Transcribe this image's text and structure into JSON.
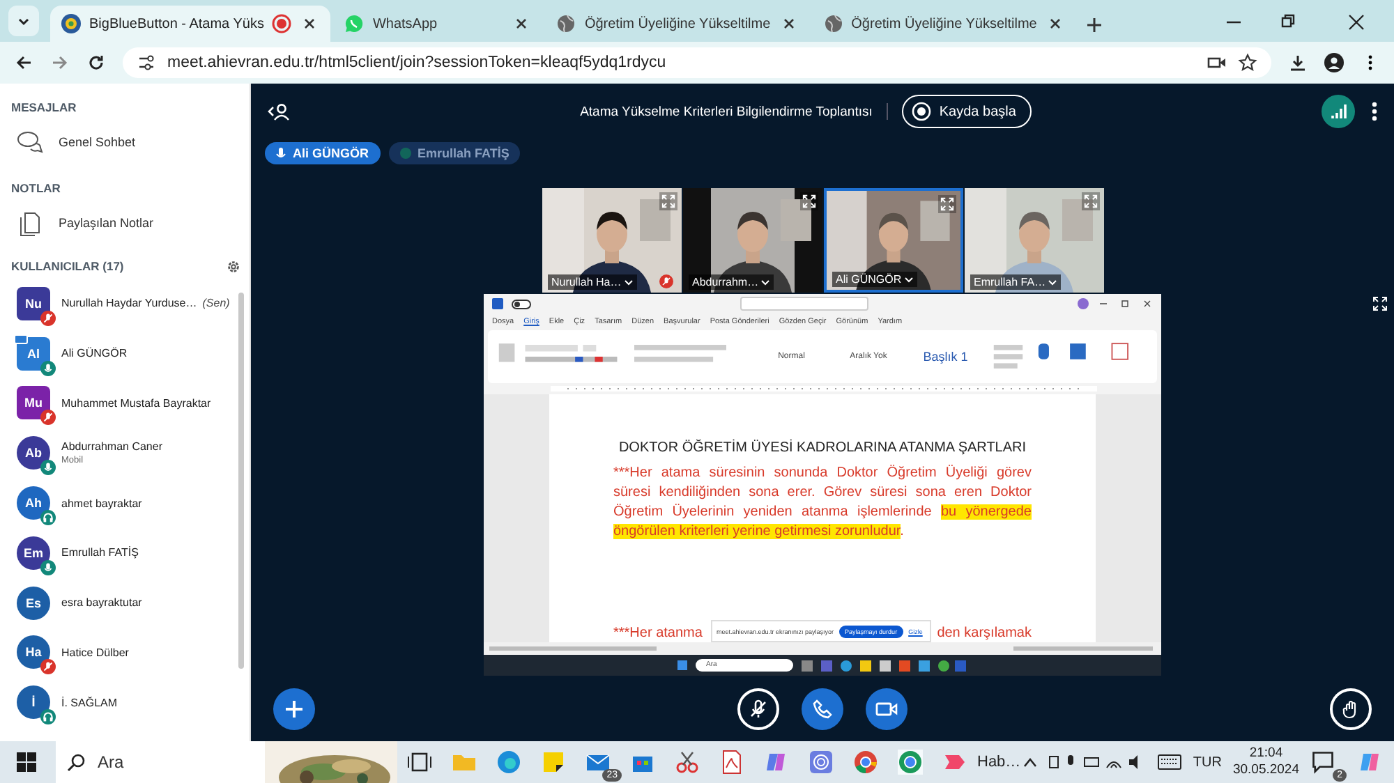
{
  "browser": {
    "tabs": [
      {
        "title": "BigBlueButton - Atama Yüks",
        "kind": "bbb",
        "selected": true,
        "recording": true
      },
      {
        "title": "WhatsApp",
        "kind": "whatsapp",
        "selected": false,
        "recording": false
      },
      {
        "title": "Öğretim Üyeliğine Yükseltilme",
        "kind": "globe",
        "selected": false,
        "recording": false
      },
      {
        "title": "Öğretim Üyeliğine Yükseltilme",
        "kind": "globe",
        "selected": false,
        "recording": false
      }
    ],
    "url": "meet.ahievran.edu.tr/html5client/join?sessionToken=kleaqf5ydq1rdycu"
  },
  "sidebar": {
    "messages_heading": "MESAJLAR",
    "chat_item": "Genel Sohbet",
    "notes_heading": "NOTLAR",
    "notes_item": "Paylaşılan Notlar",
    "users_heading": "KULLANICILAR (17)",
    "users": [
      {
        "initials": "Nu",
        "name": "Nurullah Haydar Yurduse…",
        "you": "(Sen)",
        "color": "#3b3a98",
        "moderator": true,
        "presenter": false,
        "kind": "muted"
      },
      {
        "initials": "Al",
        "name": "Ali GÜNGÖR",
        "color": "#2a7bd1",
        "moderator": true,
        "presenter": true,
        "kind": "mic"
      },
      {
        "initials": "Mu",
        "name": "Muhammet Mustafa Bayraktar",
        "color": "#7b22a8",
        "moderator": true,
        "presenter": false,
        "kind": "muted"
      },
      {
        "initials": "Ab",
        "name": "Abdurrahman Caner",
        "subtitle": "Mobil",
        "color": "#3b3a98",
        "moderator": false,
        "presenter": false,
        "kind": "mic"
      },
      {
        "initials": "Ah",
        "name": "ahmet bayraktar",
        "color": "#1f68c0",
        "moderator": false,
        "presenter": false,
        "kind": "listen"
      },
      {
        "initials": "Em",
        "name": "Emrullah FATİŞ",
        "color": "#3b3a98",
        "moderator": false,
        "presenter": false,
        "kind": "mic"
      },
      {
        "initials": "Es",
        "name": "esra bayraktutar",
        "color": "#1d5fa6",
        "moderator": false,
        "presenter": false,
        "kind": "none"
      },
      {
        "initials": "Ha",
        "name": "Hatice Dülber",
        "color": "#1d5fa6",
        "moderator": false,
        "presenter": false,
        "kind": "muted"
      },
      {
        "initials": "İ",
        "name": "İ. SAĞLAM",
        "color": "#1d5fa6",
        "moderator": false,
        "presenter": false,
        "kind": "listen"
      }
    ]
  },
  "meeting": {
    "title": "Atama Yükselme Kriterleri Bilgilendirme Toplantısı",
    "record_label": "Kayda başla",
    "talkers": [
      {
        "name": "Ali GÜNGÖR",
        "talking": true
      },
      {
        "name": "Emrullah FATİŞ",
        "talking": false
      }
    ],
    "videos": [
      {
        "name": "Nurullah Ha…",
        "talking": false,
        "muted": true,
        "kind": "picture"
      },
      {
        "name": "Abdurrahm…",
        "talking": false,
        "muted": false,
        "kind": "picture"
      },
      {
        "name": "Ali GÜNGÖR",
        "talking": true,
        "muted": false,
        "kind": "picture"
      },
      {
        "name": "Emrullah FA…",
        "talking": false,
        "muted": false,
        "kind": "picture"
      }
    ],
    "screenshare": {
      "autosave_on": false,
      "ribbon_tabs": [
        "Dosya",
        "Giriş",
        "Ekle",
        "Çiz",
        "Tasarım",
        "Düzen",
        "Başvurular",
        "Posta Gönderileri",
        "Gözden Geçir",
        "Görünüm",
        "Yardım"
      ],
      "styles": [
        "Normal",
        "Aralık Yok",
        "Başlık 1"
      ],
      "doc_title": "DOKTOR ÖĞRETİM ÜYESİ KADROLARINA ATANMA ŞARTLARI",
      "paragraph": [
        {
          "text": "***Her atama süresinin sonunda Doktor Öğretim Üyeliği görev süresi kendiliğinden sona erer. Görev süresi sona eren Doktor Öğretim Üyelerinin yeniden atanma işlemlerinde ",
          "highlighted": false
        },
        {
          "text": "bu yönergede öngörülen kriterleri yerine getirmesi zorunludur",
          "highlighted": true
        },
        {
          "text": ".",
          "highlighted": false
        }
      ],
      "next_line_start": "***Her atanma",
      "next_line_end": "den karşılamak",
      "share_notice": "meet.ahievran.edu.tr ekranınızı paylaşıyor",
      "stop_label": "Paylaşmayı durdur",
      "hide_label": "Gizle",
      "inner_search": "Ara"
    }
  },
  "taskbar": {
    "search": "Ara",
    "mail_badge": "23",
    "app_label": "Hab…",
    "language": "TUR",
    "time": "21:04",
    "date": "30.05.2024",
    "notifications": "2"
  }
}
